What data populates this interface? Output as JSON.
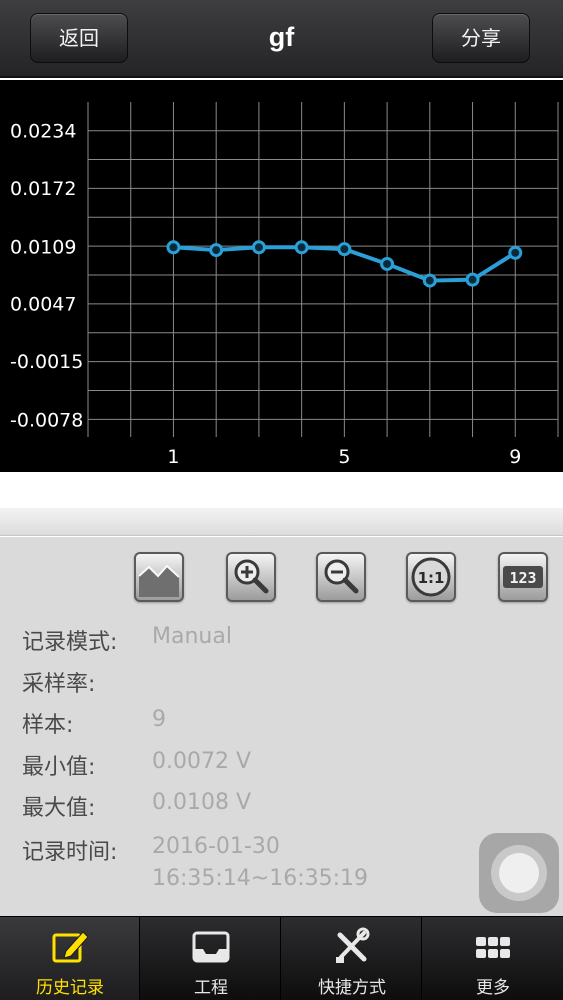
{
  "nav": {
    "back_label": "返回",
    "title": "gf",
    "share_label": "分享"
  },
  "chart_data": {
    "type": "line",
    "x": [
      1,
      2,
      3,
      4,
      5,
      6,
      7,
      8,
      9
    ],
    "series": [
      {
        "values": [
          0.0108,
          0.0105,
          0.0108,
          0.0108,
          0.0106,
          0.009,
          0.0072,
          0.0073,
          0.0102
        ]
      }
    ],
    "x_ticks": [
      "1",
      "5",
      "9"
    ],
    "y_ticks": [
      "0.0234",
      "0.0172",
      "0.0109",
      "0.0047",
      "-0.0015",
      "-0.0078"
    ],
    "ylim": [
      -0.0097,
      0.0265
    ],
    "xlim": [
      -1,
      10
    ],
    "grid": true,
    "line_color": "#2a9fd8"
  },
  "toolbar": {
    "buttons": [
      "line-chart-icon",
      "zoom-in-icon",
      "zoom-out-icon",
      "one-to-one-icon",
      "numbers-icon"
    ]
  },
  "info": {
    "mode_label": "记录模式:",
    "mode_value": "Manual",
    "rate_label": "采样率:",
    "samples_label": "样本:",
    "samples_value": "9",
    "min_label": "最小值:",
    "min_value": "0.0072 V",
    "max_label": "最大值:",
    "max_value": "0.0108 V",
    "time_label": "记录时间:",
    "time_date": "2016-01-30",
    "time_range": "16:35:14~16:35:19"
  },
  "tabs": [
    {
      "label": "历史记录",
      "icon": "edit-icon",
      "active": true
    },
    {
      "label": "工程",
      "icon": "inbox-icon",
      "active": false
    },
    {
      "label": "快捷方式",
      "icon": "tools-icon",
      "active": false
    },
    {
      "label": "更多",
      "icon": "grid-icon",
      "active": false
    }
  ],
  "colors": {
    "active_tab": "#ffe100",
    "chart_bg": "#000000",
    "grid": "#8a8a8a"
  }
}
